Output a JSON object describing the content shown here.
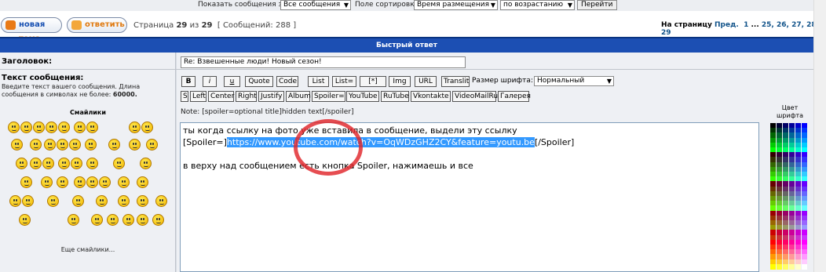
{
  "topbar": {
    "show_label": "Показать сообщения за:",
    "period": "Все сообщения",
    "sort_label": "Поле сортировки",
    "sort_field": "Время размещения",
    "sort_order": "по возрастанию",
    "go": "Перейти"
  },
  "actions": {
    "new_topic_a": "новая",
    "new_topic_b": "тема",
    "reply": "ответить"
  },
  "paging": {
    "page_word": "Страница",
    "current": "29",
    "of": "из",
    "total": "29",
    "count": "[ Сообщений: 288 ]",
    "to_page": "На страницу",
    "prev": "Пред.",
    "links": [
      "1",
      "...",
      "25,",
      "26,",
      "27,",
      "28,",
      "29"
    ]
  },
  "quick_reply": {
    "title": "Быстрый ответ"
  },
  "form": {
    "subject_label": "Заголовок:",
    "subject_value": "Re: Взвешенные люди! Новый сезон!",
    "message_label": "Текст сообщения:",
    "message_hint": "Введите текст вашего сообщения. Длина сообщения в символах не более:",
    "max_len": "60000.",
    "smilies_title": "Смайлики",
    "more_smilies": "Еще смайлики...",
    "font_size_label": "Размер шрифта:",
    "font_size_value": "Нормальный",
    "note": "Note: [spoiler=optional title]hidden text[/spoiler]",
    "color_title": "Цвет шрифта"
  },
  "toolbar": {
    "row1": [
      "B",
      "i",
      "u",
      "Quote",
      "Code",
      "List",
      "List=",
      "[*]",
      "Img",
      "URL",
      "Translit"
    ],
    "row2": [
      "S",
      "Left",
      "Center",
      "Right",
      "Justify",
      "Album",
      "Spoiler=",
      "YouTube",
      "RuTube",
      "Vkontakte",
      "VideoMailRu",
      "Галерея"
    ]
  },
  "message": {
    "line1": "ты когда ссылку на фото уже вставила в сообщение, выдели эту ссылку",
    "line2_pre": "[Spoiler=]",
    "line2_sel": "https://www.youtube.com/watch?v=OqWDzGHZ2CY&feature=youtu.be",
    "line2_post": "[/Spoiler]",
    "line3": "",
    "line4": "в верху над сообщением есть кнопка Spoiler, нажимаешь и все"
  },
  "colors": {
    "header_blue": "#1c4fb3",
    "selection": "#3399ff",
    "annotation_red": "#e0262b"
  }
}
